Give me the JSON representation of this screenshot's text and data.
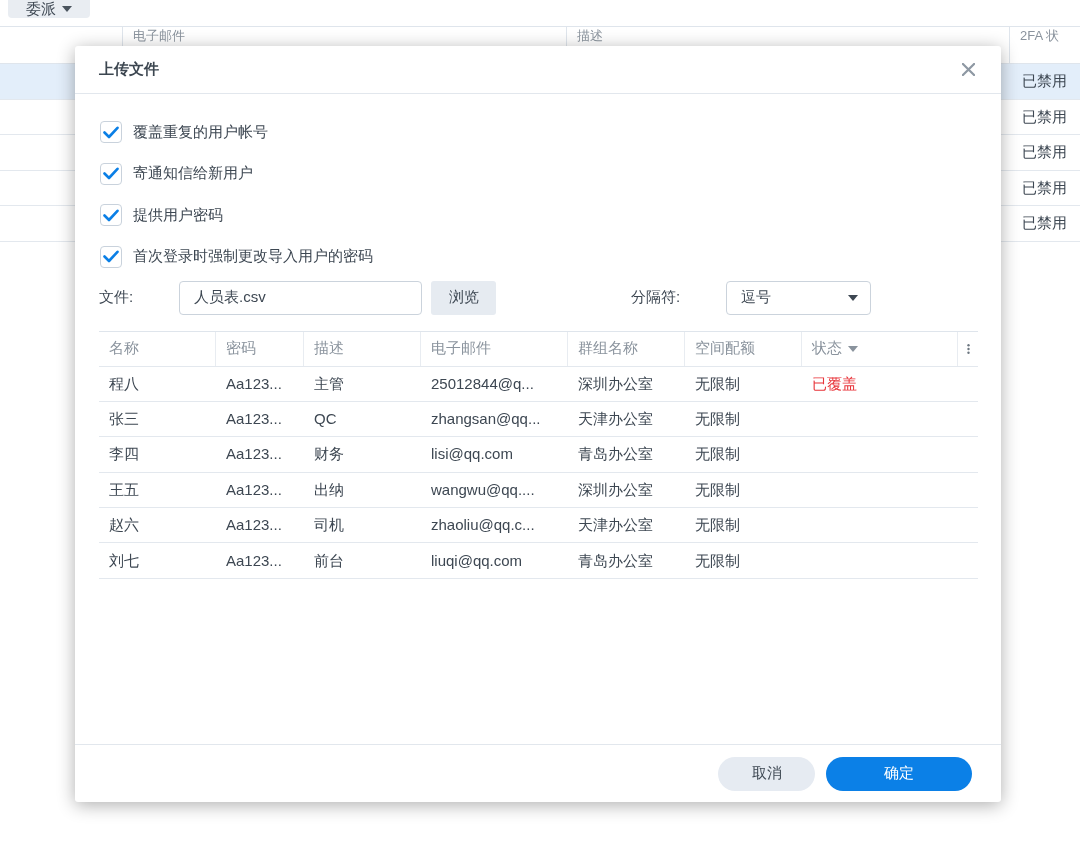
{
  "background": {
    "toolbar_button": "委派",
    "table": {
      "columns": [
        "电子邮件",
        "描述",
        "2FA 状"
      ],
      "rows": [
        {
          "2fa_status": "已禁用",
          "selected": true
        },
        {
          "2fa_status": "已禁用",
          "selected": false
        },
        {
          "2fa_status": "已禁用",
          "selected": false
        },
        {
          "2fa_status": "已禁用",
          "selected": false
        },
        {
          "2fa_status": "已禁用",
          "selected": false
        }
      ]
    }
  },
  "dialog": {
    "title": "上传文件",
    "options": [
      {
        "label": "覆盖重复的用户帐号",
        "checked": true
      },
      {
        "label": "寄通知信给新用户",
        "checked": true
      },
      {
        "label": "提供用户密码",
        "checked": true
      },
      {
        "label": "首次登录时强制更改导入用户的密码",
        "checked": true
      }
    ],
    "file": {
      "label": "文件:",
      "value": "人员表.csv",
      "browse_button": "浏览"
    },
    "delimiter": {
      "label": "分隔符:",
      "value": "逗号"
    },
    "table": {
      "columns": [
        {
          "label": "名称",
          "sorted": false
        },
        {
          "label": "密码",
          "sorted": false
        },
        {
          "label": "描述",
          "sorted": false
        },
        {
          "label": "电子邮件",
          "sorted": false
        },
        {
          "label": "群组名称",
          "sorted": false
        },
        {
          "label": "空间配额",
          "sorted": false
        },
        {
          "label": "状态",
          "sorted": true
        }
      ],
      "rows": [
        {
          "cells": [
            "程八",
            "Aa123...",
            "主管",
            "25012844@q...",
            "深圳办公室",
            "无限制"
          ],
          "status": "已覆盖"
        },
        {
          "cells": [
            "张三",
            "Aa123...",
            "QC",
            "zhangsan@qq...",
            "天津办公室",
            "无限制"
          ]
        },
        {
          "cells": [
            "李四",
            "Aa123...",
            "财务",
            "lisi@qq.com",
            "青岛办公室",
            "无限制"
          ]
        },
        {
          "cells": [
            "王五",
            "Aa123...",
            "出纳",
            "wangwu@qq....",
            "深圳办公室",
            "无限制"
          ]
        },
        {
          "cells": [
            "赵六",
            "Aa123...",
            "司机",
            "zhaoliu@qq.c...",
            "天津办公室",
            "无限制"
          ]
        },
        {
          "cells": [
            "刘七",
            "Aa123...",
            "前台",
            "liuqi@qq.com",
            "青岛办公室",
            "无限制"
          ]
        }
      ]
    },
    "buttons": [
      {
        "label": "取消",
        "kind": "secondary"
      },
      {
        "label": "确定",
        "kind": "primary"
      }
    ]
  }
}
